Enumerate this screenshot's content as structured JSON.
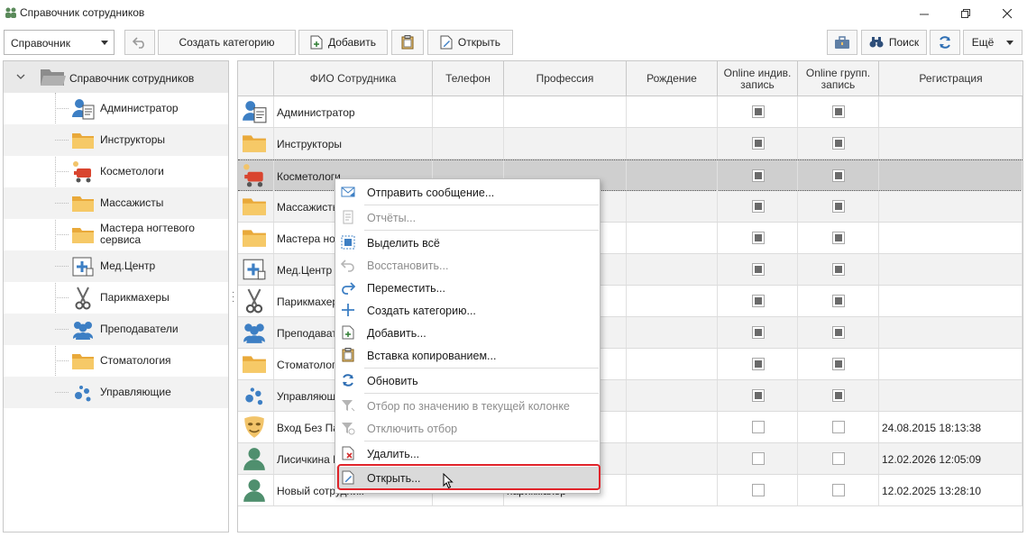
{
  "window": {
    "title": "Справочник сотрудников"
  },
  "toolbar": {
    "combo_value": "Справочник",
    "create_category": "Создать категорию",
    "add": "Добавить",
    "open": "Открыть",
    "search": "Поиск",
    "more": "Ещё"
  },
  "tree": {
    "root": "Справочник сотрудников",
    "items": [
      {
        "label": "Администратор",
        "icon": "admin-icon"
      },
      {
        "label": "Инструкторы",
        "icon": "folder-icon"
      },
      {
        "label": "Косметологи",
        "icon": "cosmetology-icon"
      },
      {
        "label": "Массажисты",
        "icon": "folder-icon"
      },
      {
        "label": "Мастера ногтевого сервиса",
        "icon": "folder-icon"
      },
      {
        "label": "Мед.Центр",
        "icon": "medical-icon"
      },
      {
        "label": "Парикмахеры",
        "icon": "scissors-icon"
      },
      {
        "label": "Преподаватели",
        "icon": "group-icon"
      },
      {
        "label": "Стоматология",
        "icon": "folder-icon"
      },
      {
        "label": "Управляющие",
        "icon": "dots-icon"
      }
    ]
  },
  "grid": {
    "headers": {
      "fio": "ФИО Сотрудника",
      "phone": "Телефон",
      "profession": "Профессия",
      "birth": "Рождение",
      "online_ind": "Online индив. запись",
      "online_grp": "Online групп. запись",
      "registration": "Регистрация"
    },
    "rows": [
      {
        "name": "Администратор",
        "profession": "",
        "registration": ""
      },
      {
        "name": "Инструкторы",
        "profession": "",
        "registration": ""
      },
      {
        "name": "Косметологи",
        "profession": "",
        "registration": ""
      },
      {
        "name": "Массажисты",
        "profession": "",
        "registration": ""
      },
      {
        "name": "Мастера ног",
        "profession": "",
        "registration": ""
      },
      {
        "name": "Мед.Центр",
        "profession": "",
        "registration": ""
      },
      {
        "name": "Парикмахеры",
        "profession": "",
        "registration": ""
      },
      {
        "name": "Преподавате",
        "profession": "",
        "registration": ""
      },
      {
        "name": "Стоматологи",
        "profession": "",
        "registration": ""
      },
      {
        "name": "Управляющи",
        "profession": "",
        "registration": ""
      },
      {
        "name": "Вход Без Пар",
        "profession": "",
        "registration": "24.08.2015 18:13:38"
      },
      {
        "name": "Лисичкина Е",
        "profession": "",
        "registration": "12.02.2026 12:05:09"
      },
      {
        "name": "Новый сотрудник",
        "profession": "парикмахер",
        "registration": "12.02.2025 13:28:10"
      }
    ]
  },
  "context_menu": {
    "send_message": "Отправить сообщение...",
    "reports": "Отчёты...",
    "select_all": "Выделить всё",
    "restore": "Восстановить...",
    "move": "Переместить...",
    "create_category": "Создать категорию...",
    "add": "Добавить...",
    "paste_copy": "Вставка копированием...",
    "refresh": "Обновить",
    "filter_by_value": "Отбор по значению в текущей колонке",
    "disable_filter": "Отключить отбор",
    "delete": "Удалить...",
    "open": "Открыть..."
  },
  "colors": {
    "highlight_border": "#e0242b",
    "folder": "#f3c15f",
    "blue_icon": "#3d7fc4"
  }
}
